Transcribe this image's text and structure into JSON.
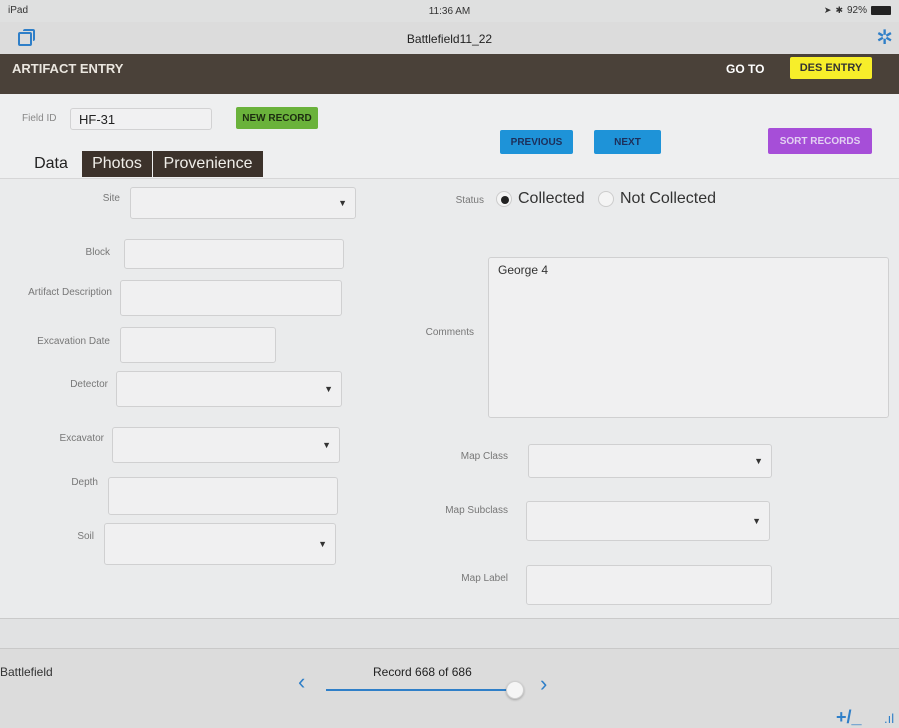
{
  "status_bar": {
    "device": "iPad",
    "time": "11:36 AM",
    "battery": "92%"
  },
  "file": {
    "title": "Battlefield11_22"
  },
  "app_header": {
    "title": "ARTIFACT ENTRY",
    "goto_label": "GO TO",
    "des_entry_label": "DES ENTRY"
  },
  "toolbar": {
    "field_id_label": "Field ID",
    "field_id_value": "HF-31",
    "new_record_label": "NEW RECORD",
    "previous_label": "PREVIOUS",
    "next_label": "NEXT",
    "sort_records_label": "SORT RECORDS"
  },
  "tabs": [
    {
      "label": "Data"
    },
    {
      "label": "Photos"
    },
    {
      "label": "Provenience"
    }
  ],
  "form": {
    "site_label": "Site",
    "block_label": "Block",
    "artifact_description_label": "Artifact Description",
    "excavation_date_label": "Excavation Date",
    "detector_label": "Detector",
    "excavator_label": "Excavator",
    "depth_label": "Depth",
    "soil_label": "Soil",
    "status_label": "Status",
    "status_options": [
      "Collected",
      "Not Collected"
    ],
    "status_selected": "Collected",
    "comments_label": "Comments",
    "comments_value": "George 4",
    "map_class_label": "Map Class",
    "map_subclass_label": "Map Subclass",
    "map_label_label": "Map Label"
  },
  "footer": {
    "layout_name": "Battlefield",
    "record_text": "Record 668 of 686",
    "record_current": 668,
    "record_total": 686
  },
  "icons": {
    "prev_chevron": "‹",
    "next_chevron": "›",
    "dropdown": "▼",
    "plus_minus": "+/_",
    "chart": ".ıl",
    "gear": "✲"
  }
}
